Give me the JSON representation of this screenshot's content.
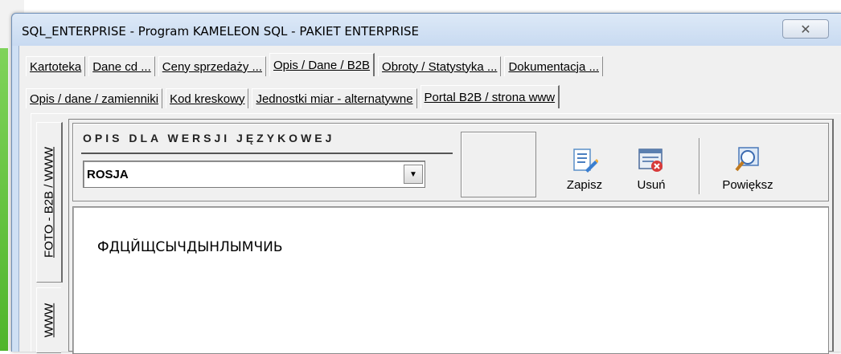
{
  "window": {
    "title": "SQL_ENTERPRISE - Program KAMELEON SQL - PAKIET ENTERPRISE",
    "close_glyph": "✕"
  },
  "tabs_row1": [
    {
      "label": "Kartoteka",
      "active": false
    },
    {
      "label": "Dane cd ...",
      "active": false
    },
    {
      "label": "Ceny sprzedaży ...",
      "active": false
    },
    {
      "label": "Opis / Dane / B2B",
      "active": true
    },
    {
      "label": "Obroty / Statystyka ...",
      "active": false
    },
    {
      "label": "Dokumentacja ...",
      "active": false
    }
  ],
  "tabs_row2": [
    {
      "label": "Opis / dane / zamienniki",
      "active": false
    },
    {
      "label": "Kod kreskowy",
      "active": false
    },
    {
      "label": "Jednostki miar - alternatywne",
      "active": false
    },
    {
      "label": "Portal B2B / strona www",
      "active": true
    }
  ],
  "side_tabs": {
    "first": "FOTO - B2B / WWW",
    "second": "WWW"
  },
  "language": {
    "label": "OPIS DLA WERSJI JĘZYKOWEJ",
    "selected": "ROSJA"
  },
  "toolbar": {
    "save_label": "Zapisz",
    "delete_label": "Usuń",
    "zoom_label": "Powiększ"
  },
  "description": {
    "text": "ФДЦЙЩСЫЧДЫНЛЫМЧИЬ"
  },
  "colors": {
    "title_bar": "#c8daf1",
    "client_bg": "#f0f0f0",
    "green_app": "#5cc036"
  }
}
